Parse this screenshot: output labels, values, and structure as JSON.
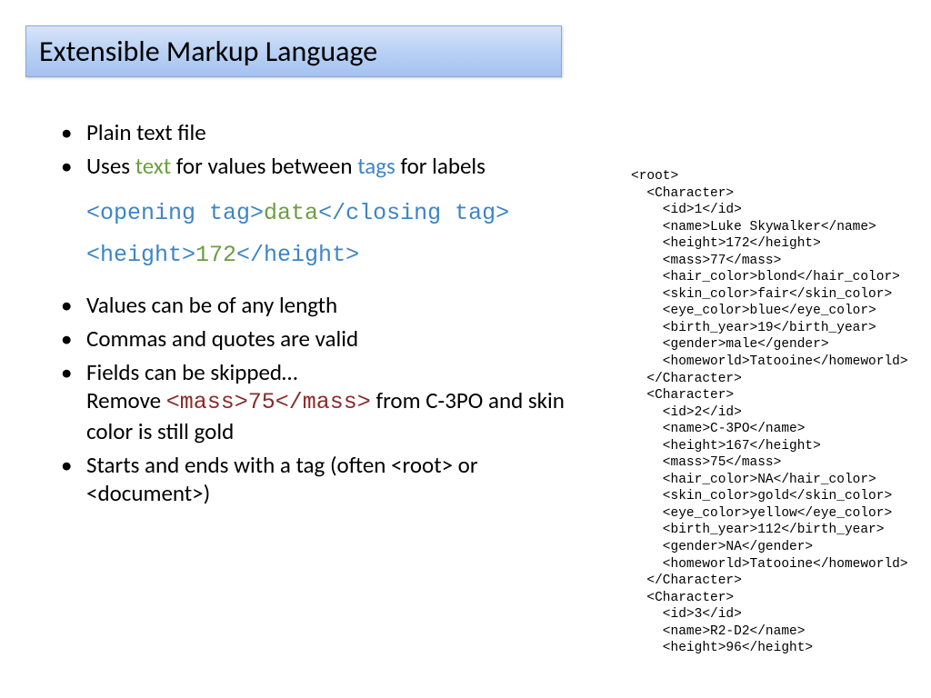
{
  "title": "Extensible Markup Language",
  "bullets": {
    "b1": "Plain text file",
    "b2_pre": "Uses ",
    "b2_text": "text",
    "b2_mid": " for values between ",
    "b2_tags": "tags",
    "b2_post": " for labels",
    "b3": "Values can be of any length",
    "b4": "Commas and quotes are valid",
    "b5_line1": "Fields can be skipped…",
    "b5_remove": "Remove ",
    "b5_mass_open": "<mass>",
    "b5_mass_val": "75",
    "b5_mass_close": "</mass>",
    "b5_rest": " from C-3PO and skin color is still gold",
    "b6": "Starts and ends with a tag (often <root> or <document>)"
  },
  "example": {
    "open_tag": "<opening tag>",
    "data_word": "data",
    "close_tag": "</closing tag>",
    "height_open": "<height>",
    "height_val": "172",
    "height_close": "</height>"
  },
  "xml": "<root>\n  <Character>\n    <id>1</id>\n    <name>Luke Skywalker</name>\n    <height>172</height>\n    <mass>77</mass>\n    <hair_color>blond</hair_color>\n    <skin_color>fair</skin_color>\n    <eye_color>blue</eye_color>\n    <birth_year>19</birth_year>\n    <gender>male</gender>\n    <homeworld>Tatooine</homeworld>\n  </Character>\n  <Character>\n    <id>2</id>\n    <name>C-3PO</name>\n    <height>167</height>\n    <mass>75</mass>\n    <hair_color>NA</hair_color>\n    <skin_color>gold</skin_color>\n    <eye_color>yellow</eye_color>\n    <birth_year>112</birth_year>\n    <gender>NA</gender>\n    <homeworld>Tatooine</homeworld>\n  </Character>\n  <Character>\n    <id>3</id>\n    <name>R2-D2</name>\n    <height>96</height>"
}
